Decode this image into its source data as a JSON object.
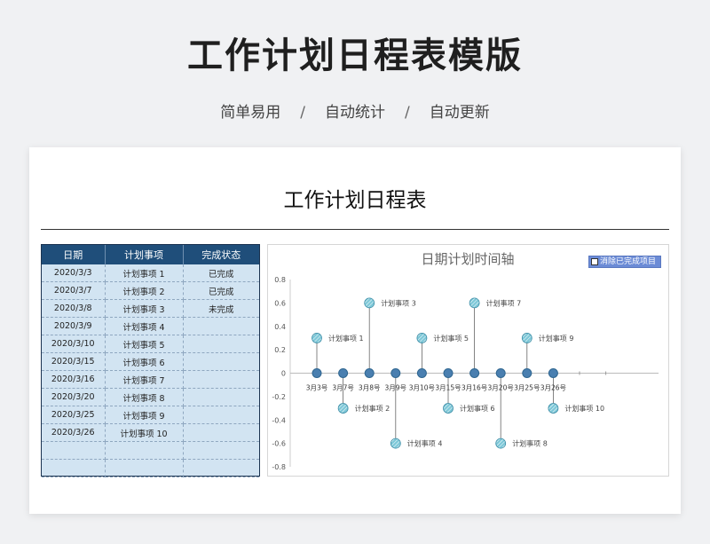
{
  "header": {
    "main_title": "工作计划日程表模版",
    "subtitle_items": [
      "简单易用",
      "自动统计",
      "自动更新"
    ],
    "separator": "/"
  },
  "sheet": {
    "title": "工作计划日程表"
  },
  "table": {
    "headers": [
      "日期",
      "计划事项",
      "完成状态"
    ],
    "rows": [
      {
        "date": "2020/3/3",
        "item": "计划事项  1",
        "status": "已完成"
      },
      {
        "date": "2020/3/7",
        "item": "计划事项  2",
        "status": "已完成"
      },
      {
        "date": "2020/3/8",
        "item": "计划事项  3",
        "status": "未完成"
      },
      {
        "date": "2020/3/9",
        "item": "计划事项  4",
        "status": ""
      },
      {
        "date": "2020/3/10",
        "item": "计划事项  5",
        "status": ""
      },
      {
        "date": "2020/3/15",
        "item": "计划事项  6",
        "status": ""
      },
      {
        "date": "2020/3/16",
        "item": "计划事项  7",
        "status": ""
      },
      {
        "date": "2020/3/20",
        "item": "计划事项  8",
        "status": ""
      },
      {
        "date": "2020/3/25",
        "item": "计划事项  9",
        "status": ""
      },
      {
        "date": "2020/3/26",
        "item": "计划事项  10",
        "status": ""
      },
      {
        "date": "",
        "item": "",
        "status": ""
      },
      {
        "date": "",
        "item": "",
        "status": ""
      }
    ]
  },
  "chart_data": {
    "type": "scatter",
    "title": "日期计划时间轴",
    "legend": {
      "label": "消除已完成项目",
      "checked": false,
      "placement": "top-right"
    },
    "ylim": [
      -0.8,
      0.8
    ],
    "yticks": [
      "0.8",
      "0.6",
      "0.4",
      "0.2",
      "0",
      "-0.2",
      "-0.4",
      "-0.6",
      "-0.8"
    ],
    "ytick_values": [
      0.8,
      0.6,
      0.4,
      0.2,
      0,
      -0.2,
      -0.4,
      -0.6,
      -0.8
    ],
    "categories": [
      "3月3号",
      "3月7号",
      "3月8号",
      "3月9号",
      "3月10号",
      "3月15号",
      "3月16号",
      "3月20号",
      "3月25号",
      "3月26号"
    ],
    "points": [
      {
        "label": "计划事项 1",
        "value": 0.3
      },
      {
        "label": "计划事项 2",
        "value": -0.3
      },
      {
        "label": "计划事项 3",
        "value": 0.6
      },
      {
        "label": "计划事项 4",
        "value": -0.6
      },
      {
        "label": "计划事项 5",
        "value": 0.3
      },
      {
        "label": "计划事项 6",
        "value": -0.3
      },
      {
        "label": "计划事项 7",
        "value": 0.6
      },
      {
        "label": "计划事项 8",
        "value": -0.6
      },
      {
        "label": "计划事项 9",
        "value": 0.3
      },
      {
        "label": "计划事项 10",
        "value": -0.3
      }
    ],
    "colors": {
      "marker_fill": "#7ec8d8",
      "marker_stroke": "#3f8fa8",
      "axis_marker": "#4a7fb0",
      "line": "#666666"
    }
  }
}
